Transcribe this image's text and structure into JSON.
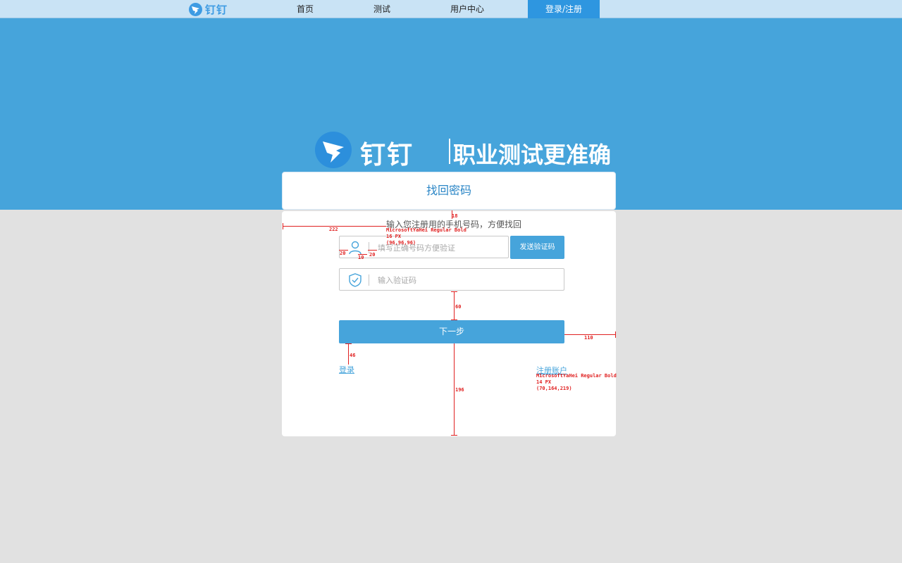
{
  "nav": {
    "logo_text": "钉钉",
    "items": [
      "首页",
      "测试",
      "用户中心",
      "登录/注册"
    ]
  },
  "banner": {
    "brand_name": "钉钉",
    "slogan": "职业测试更准确"
  },
  "card": {
    "title": "找回密码",
    "hint": "输入您注册用的手机号码，方便找回",
    "phone_placeholder": "填写正确号码方便验证",
    "send_code_label": "发送验证码",
    "code_placeholder": "输入验证码",
    "next_label": "下一步",
    "login_link": "登录",
    "register_link": "注册账户"
  },
  "annotations": {
    "hint_gap": "18",
    "card_left": "222",
    "hint_font": "MicrosoftYaHei Regular Bold",
    "hint_size": "16 PX",
    "hint_color": "(96,96,96)",
    "icon_left": "20",
    "icon_gap": "10",
    "icon_right": "20",
    "inputs_gap": "60",
    "btn_right": "110",
    "link_gap": "46",
    "bottom_gap": "196",
    "link_font": "MicrosoftYaHei Regular Bold",
    "link_size": "14 PX",
    "link_color": "(70,164,219)"
  },
  "colors": {
    "accent": "#46a4db",
    "nav_bg": "#c9e3f5",
    "page_bg": "#e1e1e1",
    "annotation": "#e02020"
  }
}
